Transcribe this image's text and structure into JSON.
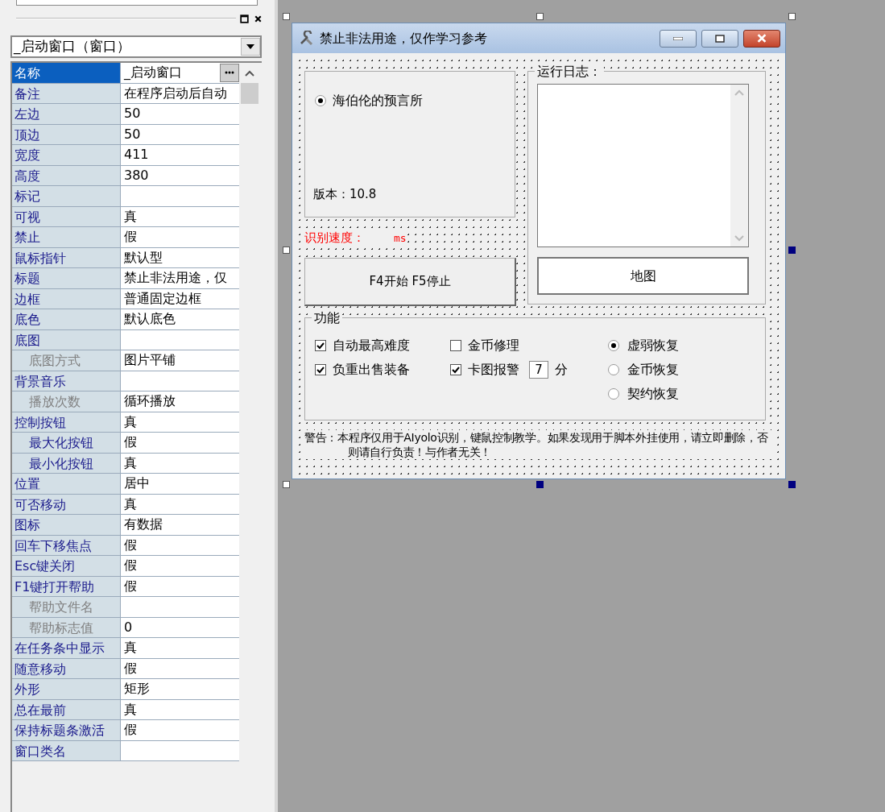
{
  "inspector": {
    "object_selector": "_启动窗口（窗口）",
    "properties": [
      {
        "name": "名称",
        "value": "_启动窗口",
        "selected": true,
        "indented": false,
        "disabled": false
      },
      {
        "name": "备注",
        "value": "在程序启动后自动",
        "selected": false,
        "indented": false,
        "disabled": false
      },
      {
        "name": "左边",
        "value": "50",
        "selected": false,
        "indented": false,
        "disabled": false
      },
      {
        "name": "顶边",
        "value": "50",
        "selected": false,
        "indented": false,
        "disabled": false
      },
      {
        "name": "宽度",
        "value": "411",
        "selected": false,
        "indented": false,
        "disabled": false
      },
      {
        "name": "高度",
        "value": "380",
        "selected": false,
        "indented": false,
        "disabled": false
      },
      {
        "name": "标记",
        "selected": false,
        "indented": false,
        "disabled": false
      },
      {
        "name": "可视",
        "value": "真",
        "selected": false,
        "indented": false,
        "disabled": false
      },
      {
        "name": "禁止",
        "value": "假",
        "selected": false,
        "indented": false,
        "disabled": false
      },
      {
        "name": "鼠标指针",
        "value": "默认型",
        "selected": false,
        "indented": false,
        "disabled": false
      },
      {
        "name": "标题",
        "value": "禁止非法用途，仅",
        "selected": false,
        "indented": false,
        "disabled": false
      },
      {
        "name": "边框",
        "value": "普通固定边框",
        "selected": false,
        "indented": false,
        "disabled": false
      },
      {
        "name": "底色",
        "value": "默认底色",
        "selected": false,
        "indented": false,
        "disabled": false
      },
      {
        "name": "底图",
        "selected": false,
        "indented": false,
        "disabled": false
      },
      {
        "name": "底图方式",
        "value": "图片平铺",
        "selected": false,
        "indented": true,
        "disabled": true
      },
      {
        "name": "背景音乐",
        "selected": false,
        "indented": false,
        "disabled": false
      },
      {
        "name": "播放次数",
        "value": "循环播放",
        "selected": false,
        "indented": true,
        "disabled": true
      },
      {
        "name": "控制按钮",
        "value": "真",
        "selected": false,
        "indented": false,
        "disabled": false
      },
      {
        "name": "最大化按钮",
        "value": "假",
        "selected": false,
        "indented": true,
        "disabled": false
      },
      {
        "name": "最小化按钮",
        "value": "真",
        "selected": false,
        "indented": true,
        "disabled": false
      },
      {
        "name": "位置",
        "value": "居中",
        "selected": false,
        "indented": false,
        "disabled": false
      },
      {
        "name": "可否移动",
        "value": "真",
        "selected": false,
        "indented": false,
        "disabled": false
      },
      {
        "name": "图标",
        "value": "有数据",
        "selected": false,
        "indented": false,
        "disabled": false
      },
      {
        "name": "回车下移焦点",
        "value": "假",
        "selected": false,
        "indented": false,
        "disabled": false
      },
      {
        "name": "Esc键关闭",
        "value": "假",
        "selected": false,
        "indented": false,
        "disabled": false
      },
      {
        "name": "F1键打开帮助",
        "value": "假",
        "selected": false,
        "indented": false,
        "disabled": false
      },
      {
        "name": "帮助文件名",
        "selected": false,
        "indented": true,
        "disabled": true
      },
      {
        "name": "帮助标志值",
        "value": "0",
        "selected": false,
        "indented": true,
        "disabled": true
      },
      {
        "name": "在任务条中显示",
        "value": "真",
        "selected": false,
        "indented": false,
        "disabled": false
      },
      {
        "name": "随意移动",
        "value": "假",
        "selected": false,
        "indented": false,
        "disabled": false
      },
      {
        "name": "外形",
        "value": "矩形",
        "selected": false,
        "indented": false,
        "disabled": false
      },
      {
        "name": "总在最前",
        "value": "真",
        "selected": false,
        "indented": false,
        "disabled": false
      },
      {
        "name": "保持标题条激活",
        "value": "假",
        "selected": false,
        "indented": false,
        "disabled": false
      },
      {
        "name": "窗口类名",
        "selected": false,
        "indented": false,
        "disabled": false
      }
    ]
  },
  "form": {
    "title": "禁止非法用途，仅作学习参考",
    "mode_radio": {
      "label": "海伯伦的预言所",
      "selected": true
    },
    "version": "版本：10.8",
    "speed_label": "识别速度：",
    "speed_unit": "ms",
    "start_button": "F4开始 F5停止",
    "log_group": "运行日志：",
    "map_button": "地图",
    "features_group": "功能",
    "checkboxes": [
      {
        "label": "自动最高难度",
        "checked": true
      },
      {
        "label": "负重出售装备",
        "checked": true
      },
      {
        "label": "金币修理",
        "checked": false
      },
      {
        "label": "卡图报警",
        "checked": true
      }
    ],
    "alarm_minutes": "7",
    "alarm_unit": "分",
    "recovery": [
      {
        "label": "虚弱恢复",
        "selected": true
      },
      {
        "label": "金币恢复",
        "selected": false
      },
      {
        "label": "契约恢复",
        "selected": false
      }
    ],
    "warning": "警告：本程序仅用于AIyolo识别，键鼠控制教学。如果发现用于脚本外挂使用，请立即删除，否则请自行负责！与作者无关！"
  }
}
